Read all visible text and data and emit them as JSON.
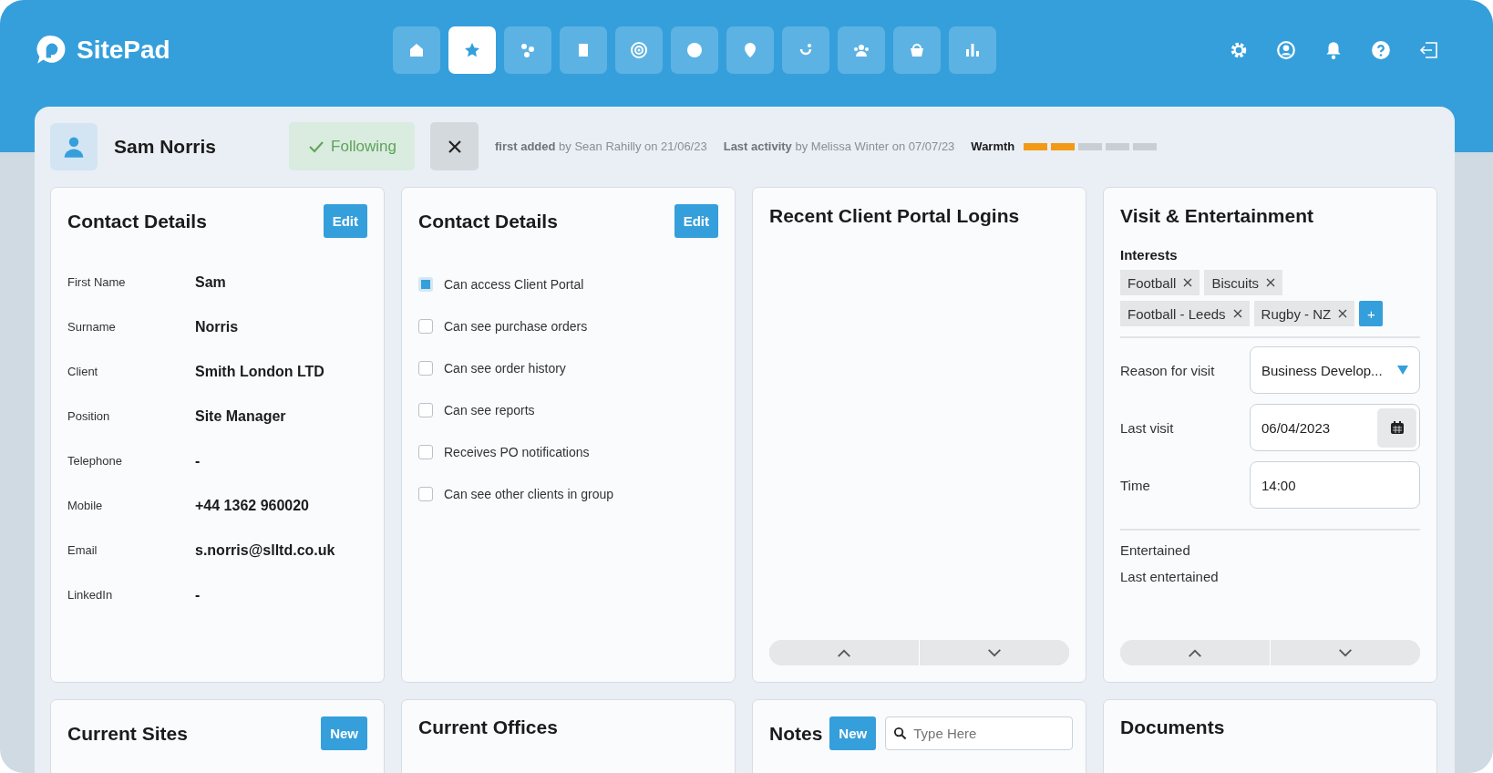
{
  "brand": {
    "name": "SitePad"
  },
  "nav": [
    {
      "selected": false
    },
    {
      "selected": true
    },
    {
      "selected": false
    },
    {
      "selected": false
    },
    {
      "selected": false
    },
    {
      "selected": false
    },
    {
      "selected": false
    },
    {
      "selected": false
    },
    {
      "selected": false
    },
    {
      "selected": false
    },
    {
      "selected": false
    }
  ],
  "contact": {
    "name": "Sam Norris",
    "follow_label": "Following",
    "following": true,
    "first_added": "**first added** by Sean Rahilly on 21/06/23",
    "last_activity": "**Last activity** by Melissa Winter on 07/07/23",
    "warmth": {
      "label": "Warmth",
      "level": 0.4
    }
  },
  "details_card": {
    "title": "Contact Details",
    "button": "Edit",
    "fields": [
      {
        "label": "First Name",
        "value": "Sam"
      },
      {
        "label": "Surname",
        "value": "Norris"
      },
      {
        "label": "Client",
        "value": "Smith London LTD"
      },
      {
        "label": "Position",
        "value": "Site Manager"
      },
      {
        "label": "Telephone",
        "value": "-"
      },
      {
        "label": "Mobile",
        "value": "+44 1362 960020"
      },
      {
        "label": "Email",
        "value": "s.norris@slltd.co.uk"
      },
      {
        "label": "LinkedIn",
        "value": "-"
      }
    ]
  },
  "permissions_card": {
    "title": "Contact Details",
    "button": "Edit",
    "options": [
      {
        "label": "Can access Client Portal",
        "checked": true
      },
      {
        "label": "Can see purchase orders",
        "checked": false
      },
      {
        "label": "Can see order history",
        "checked": false
      },
      {
        "label": "Can see reports",
        "checked": false
      },
      {
        "label": "Receives PO notifications",
        "checked": false
      },
      {
        "label": "Can see other clients in group",
        "checked": false
      }
    ]
  },
  "logins_card": {
    "title": "Recent Client Portal Logins"
  },
  "visit_card": {
    "title": "Visit & Entertainment",
    "interests_label": "Interests",
    "interests": [
      "Football",
      "Biscuits",
      "Football - Leeds",
      "Rugby - NZ"
    ],
    "add_label": "+",
    "reason": {
      "label": "Reason for visit",
      "value": "Business Develop..."
    },
    "last_visit": {
      "label": "Last visit",
      "value": "06/04/2023"
    },
    "time": {
      "label": "Time",
      "value": "14:00"
    },
    "extra": [
      "Entertained",
      "Last entertained"
    ]
  },
  "bottom_cards": [
    {
      "kind": "button",
      "title": "Current Sites",
      "button": "New"
    },
    {
      "kind": "plain",
      "title": "Current Offices"
    },
    {
      "kind": "search",
      "title": "Notes",
      "button": "New",
      "placeholder": "Type Here"
    },
    {
      "kind": "plain",
      "title": "Documents"
    }
  ]
}
